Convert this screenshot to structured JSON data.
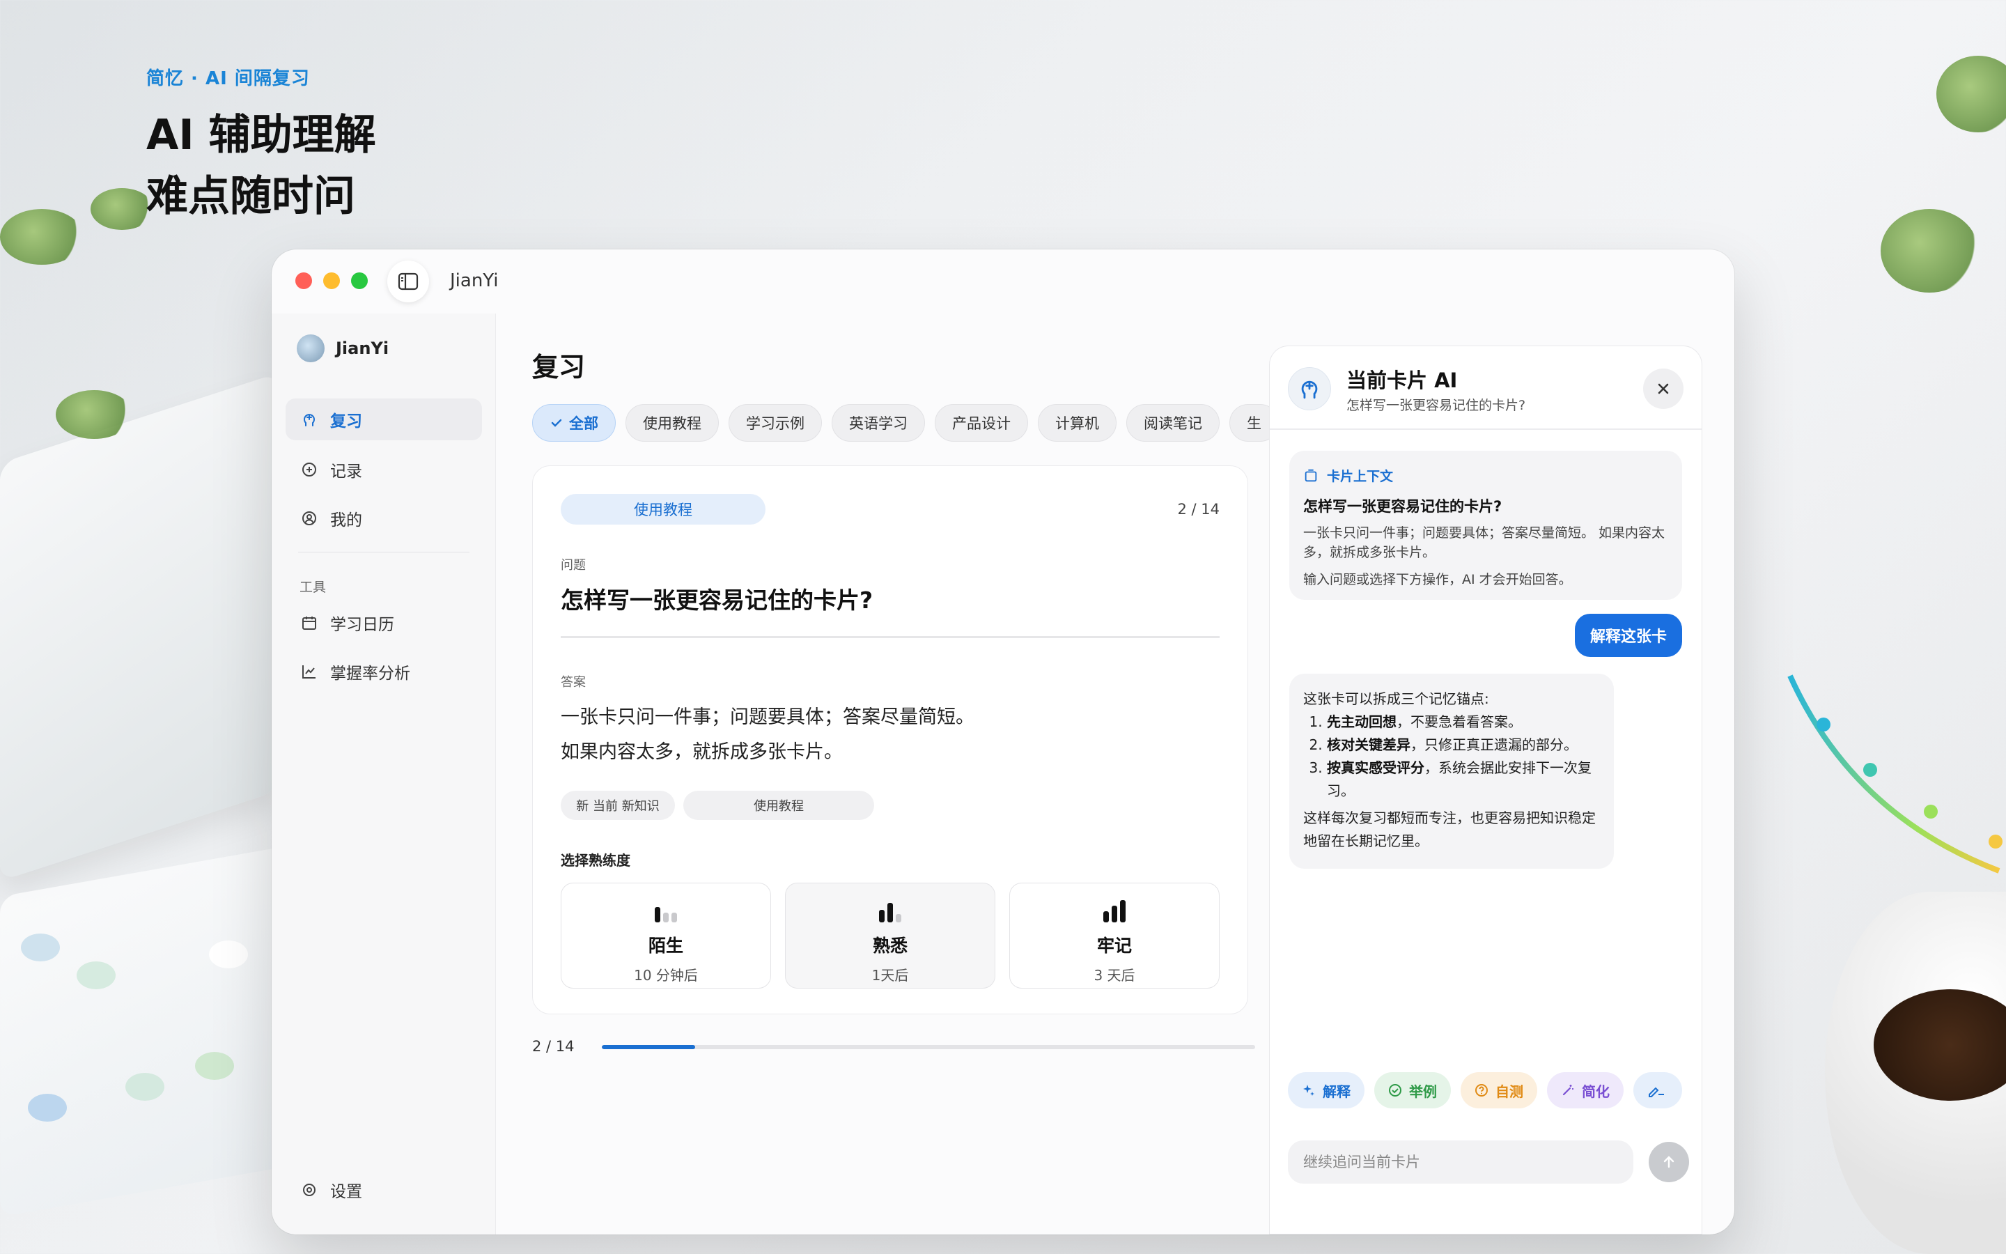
{
  "hero": {
    "kicker": "简忆 · AI 间隔复习",
    "title_line1": "AI 辅助理解",
    "title_line2": "难点随时问"
  },
  "window": {
    "title": "JianYi"
  },
  "sidebar": {
    "brand": "JianYi",
    "items": [
      {
        "label": "复习",
        "icon": "brain-icon",
        "active": true
      },
      {
        "label": "记录",
        "icon": "plus-circle-icon",
        "active": false
      },
      {
        "label": "我的",
        "icon": "person-icon",
        "active": false
      }
    ],
    "tools_label": "工具",
    "tools": [
      {
        "label": "学习日历",
        "icon": "calendar-icon"
      },
      {
        "label": "掌握率分析",
        "icon": "chart-icon"
      }
    ],
    "settings_label": "设置"
  },
  "main": {
    "title": "复习",
    "chips": [
      "全部",
      "使用教程",
      "学习示例",
      "英语学习",
      "产品设计",
      "计算机",
      "阅读笔记",
      "生"
    ],
    "active_chip": 0,
    "card": {
      "tag": "使用教程",
      "count": "2 / 14",
      "question_label": "问题",
      "question": "怎样写一张更容易记住的卡片?",
      "answer_label": "答案",
      "answer_line1": "一张卡只问一件事；问题要具体；答案尽量简短。",
      "answer_line2": "如果内容太多，就拆成多张卡片。",
      "meta_new": "新  当前 新知识",
      "meta_deck": "使用教程",
      "level_title": "选择熟练度",
      "levels": [
        {
          "name": "陌生",
          "interval": "10 分钟后",
          "strength": 1
        },
        {
          "name": "熟悉",
          "interval": "1天后",
          "strength": 2
        },
        {
          "name": "牢记",
          "interval": "3 天后",
          "strength": 3
        }
      ]
    },
    "progress": {
      "label": "2 / 14",
      "value": 0.143
    }
  },
  "ai_panel": {
    "title": "当前卡片 AI",
    "subtitle": "怎样写一张更容易记住的卡片?",
    "context_label": "卡片上下文",
    "context_question": "怎样写一张更容易记住的卡片?",
    "context_answer": "一张卡只问一件事；问题要具体；答案尽量简短。 如果内容太多，就拆成多张卡片。",
    "context_hint": "输入问题或选择下方操作，AI 才会开始回答。",
    "user_message": "解释这张卡",
    "bot_intro": "这张卡可以拆成三个记忆锚点:",
    "bot_points": [
      {
        "bold": "先主动回想",
        "rest": "，不要急着看答案。"
      },
      {
        "bold": "核对关键差异",
        "rest": "，只修正真正遗漏的部分。"
      },
      {
        "bold": "按真实感受评分",
        "rest": "，系统会据此安排下一次复习。"
      }
    ],
    "bot_outro": "这样每次复习都短而专注，也更容易把知识稳定地留在长期记忆里。",
    "actions": [
      {
        "label": "解释",
        "icon": "sparkle-icon",
        "color": "#1a6fd1"
      },
      {
        "label": "举例",
        "icon": "check-circle-icon",
        "color": "#2e9a47"
      },
      {
        "label": "自测",
        "icon": "question-circle-icon",
        "color": "#e08a14"
      },
      {
        "label": "简化",
        "icon": "wand-icon",
        "color": "#7a4fd3"
      },
      {
        "label": "",
        "icon": "pen-icon",
        "color": "#1a6fd1"
      }
    ],
    "input_placeholder": "继续追问当前卡片"
  }
}
